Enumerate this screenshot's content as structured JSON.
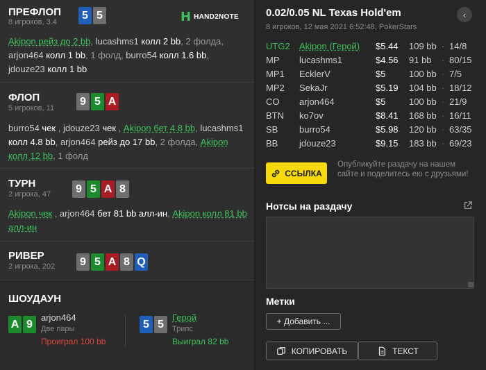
{
  "logo": {
    "mark": "H",
    "text": "HAND2NOTE"
  },
  "preflop": {
    "title": "ПРЕФЛОП",
    "sub": "8 игроков, 3.4",
    "cards": [
      {
        "rank": "5",
        "color": "c-blue"
      },
      {
        "rank": "5",
        "color": "c-grey"
      }
    ],
    "actions": [
      {
        "t": "Akipon рейз до 2 bb",
        "c": "a-hero"
      },
      {
        "t": ", ",
        "c": "a-dim"
      },
      {
        "t": "lucashms1 ",
        "c": "a-name"
      },
      {
        "t": "колл 2 bb",
        "c": "a-strong"
      },
      {
        "t": ", ",
        "c": "a-dim"
      },
      {
        "t": "2 фолда",
        "c": "a-dim"
      },
      {
        "t": ", ",
        "c": "a-dim"
      },
      {
        "t": "arjon464 ",
        "c": "a-name"
      },
      {
        "t": "колл 1 bb",
        "c": "a-strong"
      },
      {
        "t": ", ",
        "c": "a-dim"
      },
      {
        "t": "1 фолд",
        "c": "a-dim"
      },
      {
        "t": ", ",
        "c": "a-dim"
      },
      {
        "t": "burro54 ",
        "c": "a-name"
      },
      {
        "t": "колл 1.6 bb",
        "c": "a-strong"
      },
      {
        "t": ", ",
        "c": "a-dim"
      },
      {
        "t": "jdouze23 ",
        "c": "a-name"
      },
      {
        "t": "колл 1 bb",
        "c": "a-strong"
      }
    ]
  },
  "flop": {
    "title": "ФЛОП",
    "sub": "5 игроков, 11",
    "cards": [
      {
        "rank": "9",
        "color": "c-grey"
      },
      {
        "rank": "5",
        "color": "c-green"
      },
      {
        "rank": "A",
        "color": "c-red"
      }
    ],
    "actions": [
      {
        "t": "burro54 ",
        "c": "a-name"
      },
      {
        "t": "чек",
        "c": "a-strong"
      },
      {
        "t": " , ",
        "c": "a-dim"
      },
      {
        "t": "jdouze23 ",
        "c": "a-name"
      },
      {
        "t": "чек",
        "c": "a-strong"
      },
      {
        "t": " , ",
        "c": "a-dim"
      },
      {
        "t": "Akipon бет 4.8 bb",
        "c": "a-hero"
      },
      {
        "t": ", ",
        "c": "a-dim"
      },
      {
        "t": "lucashms1 ",
        "c": "a-name"
      },
      {
        "t": "колл 4.8 bb",
        "c": "a-strong"
      },
      {
        "t": ", ",
        "c": "a-dim"
      },
      {
        "t": "arjon464 ",
        "c": "a-name"
      },
      {
        "t": "рейз до 17 bb",
        "c": "a-strong"
      },
      {
        "t": ", ",
        "c": "a-dim"
      },
      {
        "t": "2 фолда",
        "c": "a-dim"
      },
      {
        "t": ", ",
        "c": "a-dim"
      },
      {
        "t": "Akipon колл 12 bb",
        "c": "a-hero"
      },
      {
        "t": ", ",
        "c": "a-dim"
      },
      {
        "t": "1 фолд",
        "c": "a-dim"
      }
    ]
  },
  "turn": {
    "title": "ТУРН",
    "sub": "2 игрока, 47",
    "cards": [
      {
        "rank": "9",
        "color": "c-grey"
      },
      {
        "rank": "5",
        "color": "c-green"
      },
      {
        "rank": "A",
        "color": "c-red"
      },
      {
        "rank": "8",
        "color": "c-grey"
      }
    ],
    "actions": [
      {
        "t": "Akipon чек",
        "c": "a-hero"
      },
      {
        "t": " , ",
        "c": "a-dim"
      },
      {
        "t": "arjon464 ",
        "c": "a-name"
      },
      {
        "t": "бет 81 bb алл-ин",
        "c": "a-strong"
      },
      {
        "t": ", ",
        "c": "a-dim"
      },
      {
        "t": "Akipon колл 81 bb алл-ин",
        "c": "a-hero"
      }
    ]
  },
  "river": {
    "title": "РИВЕР",
    "sub": "2 игрока, 202",
    "cards": [
      {
        "rank": "9",
        "color": "c-grey"
      },
      {
        "rank": "5",
        "color": "c-green"
      },
      {
        "rank": "A",
        "color": "c-red"
      },
      {
        "rank": "8",
        "color": "c-grey"
      },
      {
        "rank": "Q",
        "color": "c-blue"
      }
    ]
  },
  "showdown": {
    "title": "ШОУДАУН",
    "left": {
      "cards": [
        {
          "rank": "A",
          "color": "c-green"
        },
        {
          "rank": "9",
          "color": "c-green"
        }
      ],
      "name": "arjon464",
      "hand": "Две пары",
      "result": "Проиграл 100 bb"
    },
    "right": {
      "cards": [
        {
          "rank": "5",
          "color": "c-blue"
        },
        {
          "rank": "5",
          "color": "c-grey"
        }
      ],
      "name": "Герой",
      "hand": "Трипс",
      "result": "Выиграл 82 bb"
    }
  },
  "right": {
    "title": "0.02/0.05 NL Texas Hold'em",
    "sub": "8 игроков, 12 мая 2021 6:52:48, PokerStars",
    "back_glyph": "‹",
    "players": [
      {
        "pos": "UTG2",
        "name": "Akipon (Герой)",
        "stack": "$5.44",
        "bb": "109 bb",
        "stat": "14/8",
        "hero": true
      },
      {
        "pos": "MP",
        "name": "lucashms1",
        "stack": "$4.56",
        "bb": "91 bb",
        "stat": "80/15",
        "hero": false
      },
      {
        "pos": "MP1",
        "name": "EcklerV",
        "stack": "$5",
        "bb": "100 bb",
        "stat": "7/5",
        "hero": false
      },
      {
        "pos": "MP2",
        "name": "SekaJr",
        "stack": "$5.19",
        "bb": "104 bb",
        "stat": "18/12",
        "hero": false
      },
      {
        "pos": "CO",
        "name": "arjon464",
        "stack": "$5",
        "bb": "100 bb",
        "stat": "21/9",
        "hero": false
      },
      {
        "pos": "BTN",
        "name": "ko7ov",
        "stack": "$8.41",
        "bb": "168 bb",
        "stat": "16/11",
        "hero": false
      },
      {
        "pos": "SB",
        "name": "burro54",
        "stack": "$5.98",
        "bb": "120 bb",
        "stat": "63/35",
        "hero": false
      },
      {
        "pos": "BB",
        "name": "jdouze23",
        "stack": "$9.15",
        "bb": "183 bb",
        "stat": "69/23",
        "hero": false
      }
    ],
    "link_label": "ССЫЛКА",
    "link_desc": "Опубликуйте раздачу на нашем сайте и поделитесь ею с друзьями!",
    "notes_title": "Нотсы на раздачу",
    "notes_value": "",
    "tags_title": "Метки",
    "add_label": "+ Добавить ...",
    "copy_label": "КОПИРОВАТЬ",
    "text_label": "ТЕКСТ"
  },
  "colors": {
    "hero": "#3ec25c",
    "accent": "#f5d90a",
    "lose": "#e0453c"
  },
  "icons": [
    "hand2note-logo-icon",
    "back-arrow-icon",
    "link-icon",
    "external-link-icon",
    "copy-icon",
    "document-icon"
  ]
}
